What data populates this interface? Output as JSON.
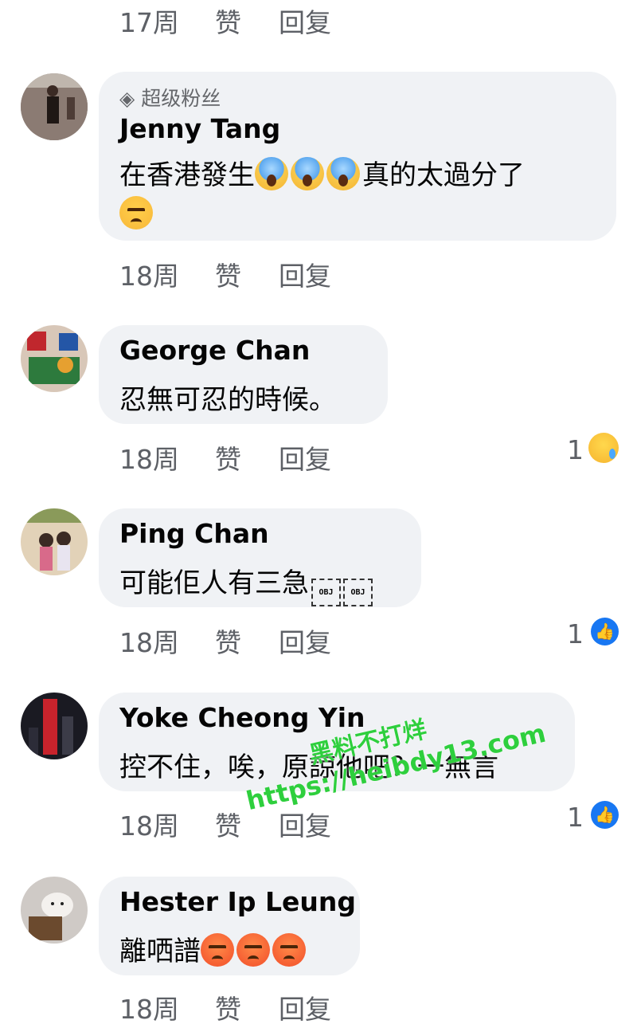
{
  "comments": [
    {
      "actions": {
        "time": "17周",
        "like": "赞",
        "reply": "回复"
      }
    },
    {
      "badge": "超级粉丝",
      "name": "Jenny Tang",
      "text_part1": "在香港發生",
      "emoji": [
        "screaming-face",
        "screaming-face",
        "screaming-face",
        "angry-face"
      ],
      "text_part2": "真的太過分了",
      "actions": {
        "time": "18周",
        "like": "赞",
        "reply": "回复"
      }
    },
    {
      "name": "George Chan",
      "text": "忍無可忍的時候。",
      "actions": {
        "time": "18周",
        "like": "赞",
        "reply": "回复"
      },
      "reaction": {
        "count": "1",
        "icon": "sad-face"
      }
    },
    {
      "name": "Ping Chan",
      "text": "可能佢人有三急",
      "obj_markers": [
        "OBJ",
        "OBJ"
      ],
      "actions": {
        "time": "18周",
        "like": "赞",
        "reply": "回复"
      },
      "reaction": {
        "count": "1",
        "icon": "like-thumb"
      }
    },
    {
      "name": "Yoke Cheong Yin",
      "text": "控不住，唉，原諒他吧？一無言",
      "actions": {
        "time": "18周",
        "like": "赞",
        "reply": "回复"
      },
      "reaction": {
        "count": "1",
        "icon": "like-thumb"
      }
    },
    {
      "name": "Hester Ip Leung",
      "text": "離哂譜",
      "emoji": [
        "pouting-face",
        "pouting-face",
        "pouting-face"
      ],
      "actions": {
        "time": "18周",
        "like": "赞",
        "reply": "回复"
      }
    }
  ],
  "watermark": {
    "line1": "黑料不打烊",
    "line2": "https://heibdy13.com"
  },
  "colors": {
    "bubble": "#f0f2f5",
    "meta": "#65676b",
    "like": "#1877f2",
    "watermark": "#2ecf3d"
  }
}
